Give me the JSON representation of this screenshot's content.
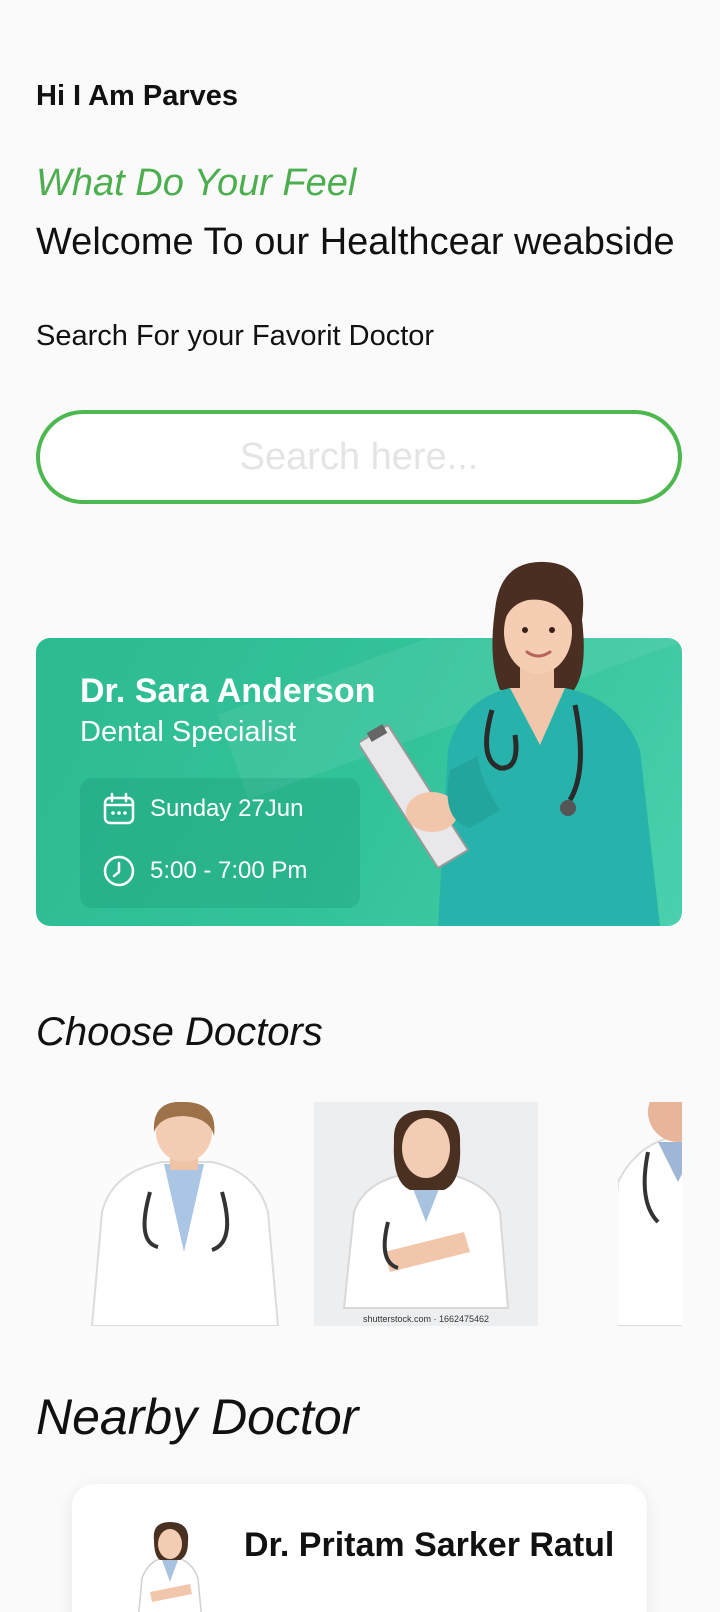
{
  "header": {
    "greeting": "Hi I Am Parves",
    "tagline": "What Do Your Feel",
    "welcome": "Welcome To our Healthcear weabside",
    "subtitle": "Search For your Favorit Doctor"
  },
  "search": {
    "placeholder": "Search here...",
    "value": ""
  },
  "featured": {
    "name": "Dr. Sara Anderson",
    "specialty": "Dental Specialist",
    "date": "Sunday 27Jun",
    "time": "5:00 - 7:00 Pm",
    "icons": [
      "calendar-icon",
      "clock-icon"
    ],
    "color": "#2dbb91"
  },
  "choose": {
    "title": "Choose Doctors",
    "watermark": "shutterstock.com · 1662475462"
  },
  "nearby": {
    "title": "Nearby Doctor",
    "doctors": [
      {
        "name": "Dr. Pritam Sarker Ratul"
      }
    ]
  },
  "colors": {
    "accent": "#4cae4f",
    "card": "#2dbb91"
  }
}
